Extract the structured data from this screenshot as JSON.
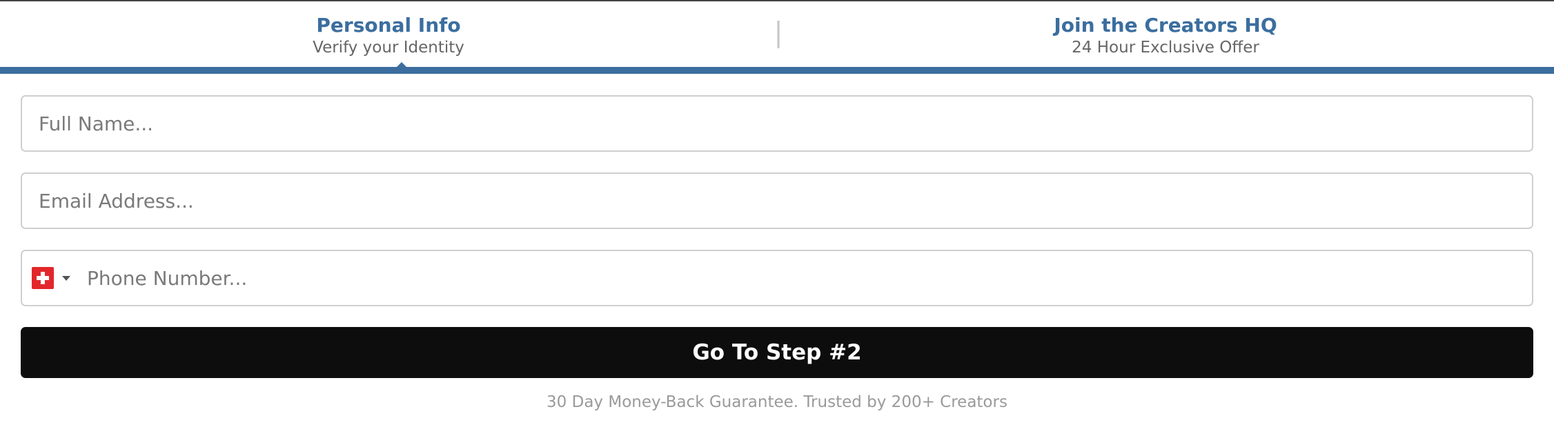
{
  "steps": [
    {
      "title": "Personal Info",
      "subtitle": "Verify your Identity",
      "active": true
    },
    {
      "title": "Join the Creators HQ",
      "subtitle": "24 Hour Exclusive Offer",
      "active": false
    }
  ],
  "form": {
    "full_name": {
      "placeholder": "Full Name...",
      "value": ""
    },
    "email": {
      "placeholder": "Email Address...",
      "value": ""
    },
    "phone": {
      "placeholder": "Phone Number...",
      "value": "",
      "country_flag": "switzerland-flag-icon"
    },
    "submit_label": "Go To Step #2",
    "guarantee_text": "30 Day Money-Back Guarantee. Trusted by 200+ Creators"
  },
  "colors": {
    "accent": "#3b6e9f",
    "button": "#0d0d0d",
    "flag_red": "#e3262b"
  }
}
